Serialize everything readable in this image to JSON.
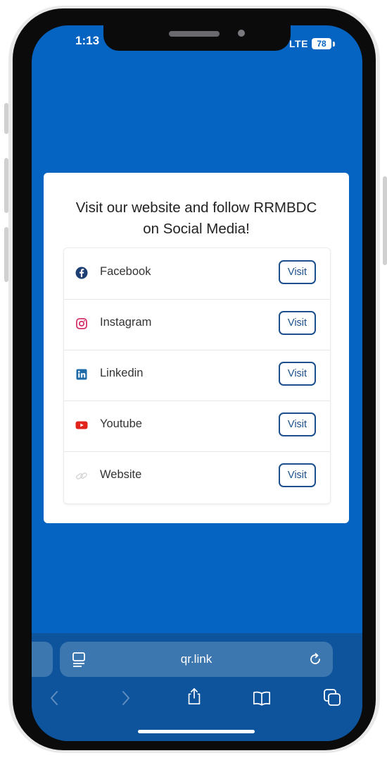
{
  "status": {
    "time": "1:13",
    "network": "LTE",
    "battery": "78"
  },
  "card": {
    "title_line1": "Visit our website and follow RRMBDC",
    "title_line2": "on Social Media!",
    "links": [
      {
        "label": "Facebook",
        "icon": "facebook-icon",
        "button": "Visit"
      },
      {
        "label": "Instagram",
        "icon": "instagram-icon",
        "button": "Visit"
      },
      {
        "label": "Linkedin",
        "icon": "linkedin-icon",
        "button": "Visit"
      },
      {
        "label": "Youtube",
        "icon": "youtube-icon",
        "button": "Visit"
      },
      {
        "label": "Website",
        "icon": "link-icon",
        "button": "Visit"
      }
    ]
  },
  "browser": {
    "url": "qr.link"
  },
  "colors": {
    "background": "#0563c2",
    "button_border": "#1c4f8c",
    "browser_bar": "#0d549c"
  }
}
